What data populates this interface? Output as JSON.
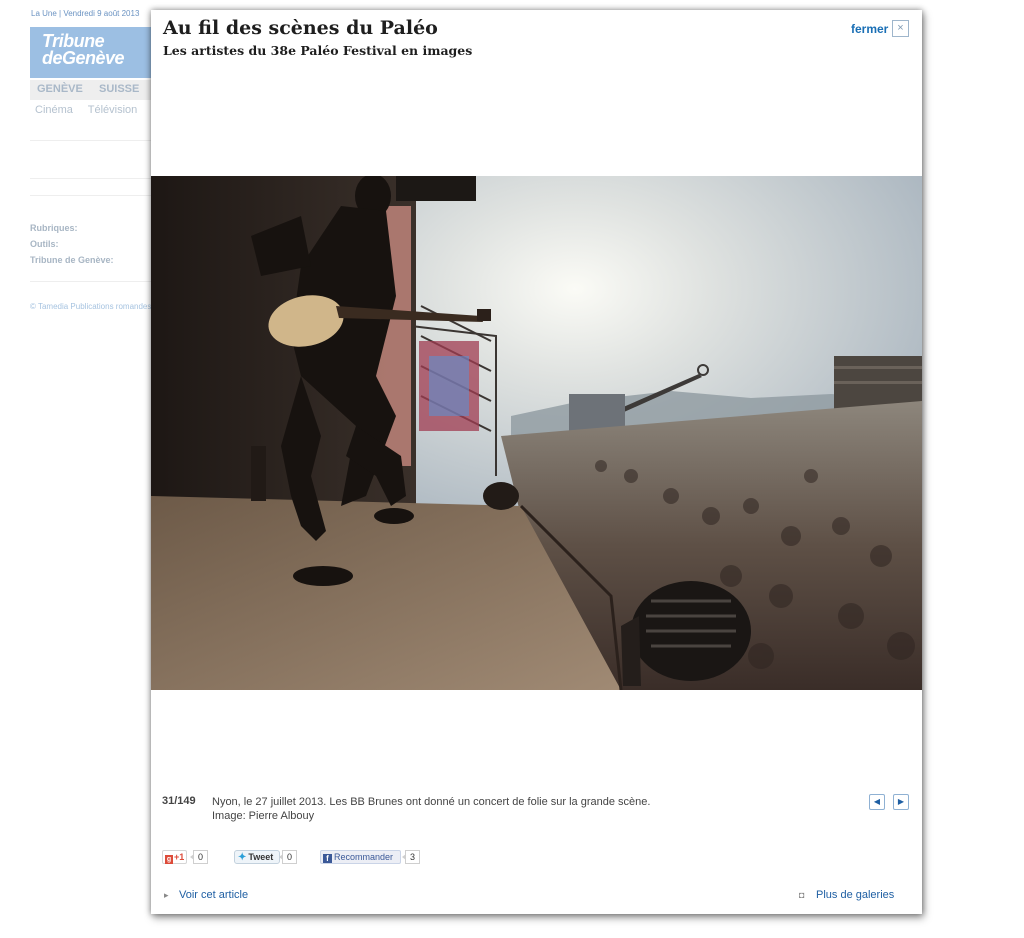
{
  "background": {
    "topline": "La Une | Vendredi 9 août 2013",
    "logo": [
      "Tribune",
      "deGenève"
    ],
    "nav": [
      "GENÈVE",
      "SUISSE"
    ],
    "subnav": [
      "Cinéma",
      "Télévision"
    ],
    "labels": [
      "Rubriques:",
      "Outils:",
      "Tribune de Genève:"
    ],
    "copyright": "© Tamedia Publications romandes"
  },
  "modal": {
    "title": "Au fil des scènes du Paléo",
    "subtitle": "Les artistes du 38e Paléo Festival en images",
    "close_label": "fermer",
    "close_icon": "×",
    "counter": "31/149",
    "caption": "Nyon, le 27 juillet 2013. Les BB Brunes ont donné un concert de folie sur la grande scène.",
    "credit": "Image: Pierre Albouy",
    "prev_icon": "◀",
    "next_icon": "▶",
    "social": {
      "gplus_label": "+1",
      "gplus_count": "0",
      "tweet_label": "Tweet",
      "tweet_count": "0",
      "fb_label": "Recommander",
      "fb_count": "3"
    },
    "footer": {
      "article_link": "Voir cet article",
      "galleries_link": "Plus de galeries"
    }
  },
  "colors": {
    "link": "#1f5fa3",
    "brand": "#9cbfe3"
  }
}
